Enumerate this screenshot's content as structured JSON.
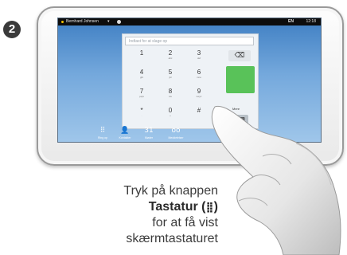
{
  "step": {
    "badge": "2"
  },
  "screen": {
    "statusbar": {
      "user": "Bernhard Johnsen",
      "chevron": "▾",
      "camera_label": "EN",
      "time": "12:18"
    },
    "keypad": {
      "search_placeholder": "Indtast for at slage op",
      "keys": [
        {
          "digit": "1",
          "letters": ""
        },
        {
          "digit": "2",
          "letters": "abc"
        },
        {
          "digit": "3",
          "letters": "def"
        },
        {
          "digit": "4",
          "letters": "ghi"
        },
        {
          "digit": "5",
          "letters": "jkl"
        },
        {
          "digit": "6",
          "letters": "mno"
        },
        {
          "digit": "7",
          "letters": "pqrs"
        },
        {
          "digit": "8",
          "letters": "tuv"
        },
        {
          "digit": "9",
          "letters": "wxyz"
        },
        {
          "digit": "*",
          "letters": "."
        },
        {
          "digit": "0",
          "letters": "+"
        },
        {
          "digit": "#",
          "letters": ""
        }
      ],
      "delete_icon": "⌫",
      "side_label": "Mere",
      "keyboard_icon": "⌨"
    },
    "nav": [
      {
        "icon": "keypad-icon",
        "glyph": "⠿",
        "label": "Ring op"
      },
      {
        "icon": "contacts-icon",
        "glyph": "👤",
        "label": "Kontakter"
      },
      {
        "icon": "calendar-icon",
        "glyph": "31",
        "label": "Møder"
      },
      {
        "icon": "voicemail-icon",
        "glyph": "oo",
        "label": "Meddelelser"
      }
    ]
  },
  "caption": {
    "line1": "Tryk på knappen",
    "line2_bold": "Tastatur",
    "line2_open": " (",
    "line2_glyph": "⣿",
    "line2_close": ")",
    "line3": "for at få vist",
    "line4": "skærmtastaturet"
  },
  "colors": {
    "accent_green": "#59c259",
    "screen_blue": "#4a88c9"
  }
}
